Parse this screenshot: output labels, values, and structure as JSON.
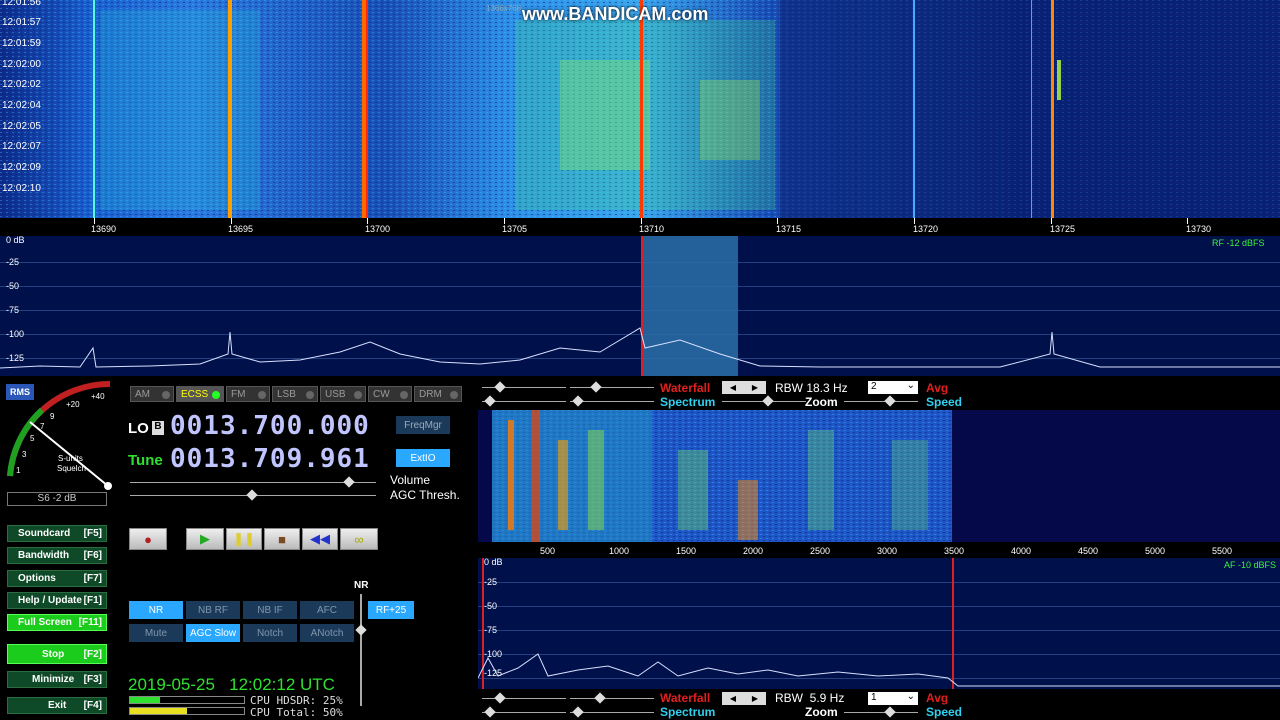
{
  "watermark": {
    "text": "www.BANDICAM.com",
    "sub": "1366x768"
  },
  "waterfall": {
    "timestamps": [
      "12:01:56",
      "12:01:57",
      "12:01:59",
      "12:02:00",
      "12:02:02",
      "12:02:04",
      "12:02:05",
      "12:02:07",
      "12:02:09",
      "12:02:10"
    ]
  },
  "freq_axis": {
    "labels": [
      "13690",
      "13695",
      "13700",
      "13705",
      "13710",
      "13715",
      "13720",
      "13725",
      "13730"
    ]
  },
  "spectrum": {
    "db_labels": [
      "0 dB",
      "-25",
      "-50",
      "-75",
      "-100",
      "-125"
    ],
    "rf_level": "RF -12 dBFS"
  },
  "smeter": {
    "badge": "RMS",
    "reading": "S6 -2 dB",
    "label1": "S-units",
    "label2": "Squelch",
    "scale": [
      "+40",
      "+20",
      "9",
      "7",
      "5",
      "3",
      "1"
    ]
  },
  "modes": [
    {
      "label": "AM",
      "active": false
    },
    {
      "label": "ECSS",
      "active": true
    },
    {
      "label": "FM",
      "active": false
    },
    {
      "label": "LSB",
      "active": false
    },
    {
      "label": "USB",
      "active": false
    },
    {
      "label": "CW",
      "active": false
    },
    {
      "label": "DRM",
      "active": false
    }
  ],
  "lo": {
    "label": "LO",
    "badge": "B",
    "value": "0013.700.000"
  },
  "tune": {
    "label": "Tune",
    "value": "0013.709.961"
  },
  "buttons": {
    "freqmgr": "FreqMgr",
    "extio": "ExtIO",
    "rf25": "RF+25"
  },
  "slider_labels": {
    "volume": "Volume",
    "agc": "AGC Thresh."
  },
  "side_buttons": [
    {
      "label": "Soundcard",
      "key": "[F5]"
    },
    {
      "label": "Bandwidth",
      "key": "[F6]"
    },
    {
      "label": "Options",
      "key": "[F7]"
    },
    {
      "label": "Help / Update",
      "key": "[F1]"
    },
    {
      "label": "Full Screen",
      "key": "[F11]"
    },
    {
      "label": "Stop",
      "key": "[F2]"
    },
    {
      "label": "Minimize",
      "key": "[F3]"
    },
    {
      "label": "Exit",
      "key": "[F4]"
    }
  ],
  "nr_label": "NR",
  "dsp_buttons": [
    "NR",
    "NB RF",
    "NB IF",
    "AFC",
    "Mute",
    "AGC Slow",
    "Notch",
    "ANotch"
  ],
  "status": {
    "datetime": "2019-05-25   12:02:12 UTC",
    "cpu_hdsdr": "CPU HDSDR: 25%",
    "cpu_total": "CPU Total: 50%"
  },
  "rf_controls": {
    "waterfall": "Waterfall",
    "spectrum": "Spectrum",
    "rbw": "RBW 18.3 Hz",
    "zoom": "Zoom",
    "avg_value": "2",
    "avg": "Avg",
    "speed": "Speed"
  },
  "af_controls": {
    "waterfall": "Waterfall",
    "spectrum": "Spectrum",
    "rbw": "RBW  5.9 Hz",
    "zoom": "Zoom",
    "avg_value": "1",
    "avg": "Avg",
    "speed": "Speed"
  },
  "af_axis": {
    "labels": [
      "500",
      "1000",
      "1500",
      "2000",
      "2500",
      "3000",
      "3500",
      "4000",
      "4500",
      "5000",
      "5500"
    ]
  },
  "af_spectrum": {
    "db_labels": [
      "0 dB",
      "-25",
      "-50",
      "-75",
      "-100",
      "-125"
    ],
    "af_level": "AF -10 dBFS"
  },
  "colors": {
    "accent": "#2aa8ff",
    "green_btn": "#1ccc1c",
    "freq_digits": "#c0c4ff",
    "waterfall_red": "#ff3a00",
    "waterfall_bg": "#0a1f6e"
  }
}
